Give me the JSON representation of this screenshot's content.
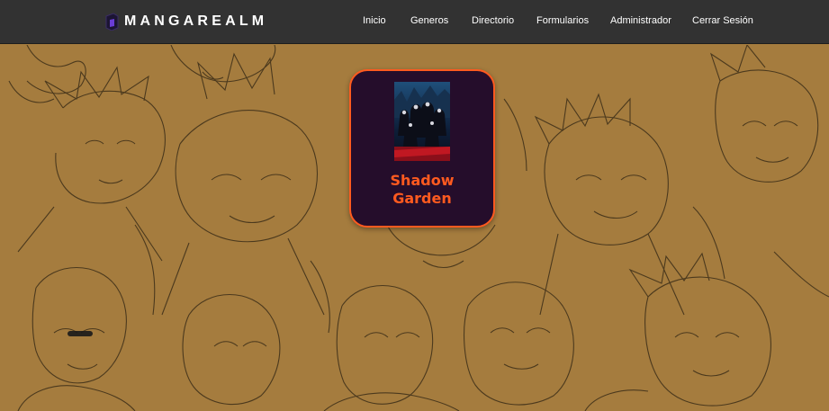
{
  "brand": {
    "name": "MANGAREALM",
    "logo_icon": "cube-logo-icon"
  },
  "nav": {
    "links": [
      "Inicio",
      "Generos",
      "Directorio",
      "Formularios",
      "Administrador",
      "Cerrar Sesión"
    ]
  },
  "card": {
    "title_line1": "Shadow",
    "title_line2": "Garden"
  },
  "colors": {
    "navbar_bg": "#323232",
    "page_bg": "#a57c3e",
    "card_bg": "#250d2b",
    "accent": "#ff5a1f",
    "line_art": "#2e2313"
  }
}
